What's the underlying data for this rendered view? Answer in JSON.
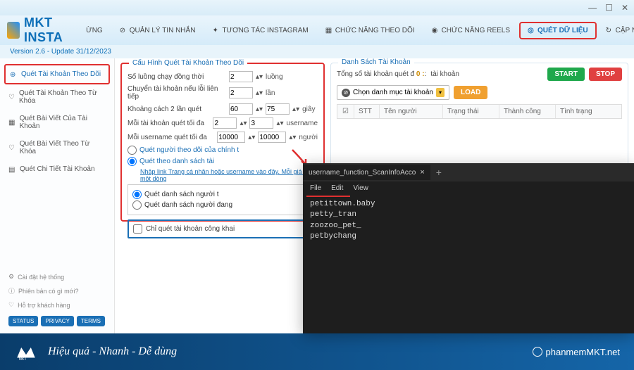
{
  "window": {
    "min": "—",
    "max": "☐",
    "close": "✕"
  },
  "logo": {
    "text": "MKT INSTA"
  },
  "tabs": [
    {
      "label": "ỪNG"
    },
    {
      "label": "QUẢN LÝ TIN NHẮN"
    },
    {
      "label": "TƯƠNG TÁC INSTAGRAM"
    },
    {
      "label": "CHỨC NĂNG THEO DÕI"
    },
    {
      "label": "CHỨC NĂNG REELS"
    },
    {
      "label": "QUÉT DỮ LIỆU"
    },
    {
      "label": "CẬP N"
    }
  ],
  "version": "Version  2.6  -  Update  31/12/2023",
  "sidebar": {
    "items": [
      "Quét Tài Khoản Theo Dõi",
      "Quét Tài Khoản Theo Từ Khóa",
      "Quét Bài Viết Của Tài Khoản",
      "Quét Bài Viết Theo Từ Khóa",
      "Quét Chi Tiết Tài Khoản"
    ],
    "foot": [
      "Cài đặt hệ thống",
      "Phiên bản có gì mới?",
      "Hỗ trợ khách hàng"
    ],
    "badges": [
      "STATUS",
      "PRIVACY",
      "TERMS"
    ]
  },
  "config": {
    "title": "Cấu Hình Quét Tài Khoản Theo Dõi",
    "rows": [
      {
        "label": "Số luồng chạy đồng thời",
        "v1": "2",
        "unit": "luồng"
      },
      {
        "label": "Chuyển tài khoản nếu lỗi liên tiếp",
        "v1": "2",
        "unit": "lần"
      },
      {
        "label": "Khoảng cách 2 lần quét",
        "v1": "60",
        "v2": "75",
        "unit": "giây"
      },
      {
        "label": "Mỗi tài khoản quét tối đa",
        "v1": "2",
        "v2": "3",
        "unit": "username"
      },
      {
        "label": "Mỗi username quét tối đa",
        "v1": "10000",
        "v2": "10000",
        "unit": "người"
      }
    ],
    "radio1": "Quét người theo dõi của chính t",
    "radio2": "Quét theo danh sách tài",
    "link": "Nhập link Trang cá nhân hoặc username vào đây. Mỗi giá trị một dòng",
    "sub1": "Quét danh sách người t",
    "sub2": "Quét danh sách người đang",
    "checkbox": "Chỉ quét tài khoản công khai"
  },
  "list": {
    "title": "Danh Sách Tài Khoản",
    "total_label": "Tổng số tài khoản quét đ",
    "count": "0 :",
    "count_unit": "tài khoản",
    "dropdown": "Chọn danh mục tài khoản",
    "load": "LOAD",
    "start": "START",
    "stop": "STOP",
    "cols": [
      "☑",
      "STT",
      "Tên người",
      "Trạng thái",
      "Thành công",
      "Tình trạng"
    ]
  },
  "notepad": {
    "tab": "username_function_ScanInfoAcco",
    "menus": [
      "File",
      "Edit",
      "View"
    ],
    "content": "petittown.baby\npetty_tran\nzoozoo_pet_\npetbychang"
  },
  "footer": {
    "slogan": "Hiệu quả - Nhanh - Dễ dùng",
    "url": "phanmemMKT.net"
  }
}
